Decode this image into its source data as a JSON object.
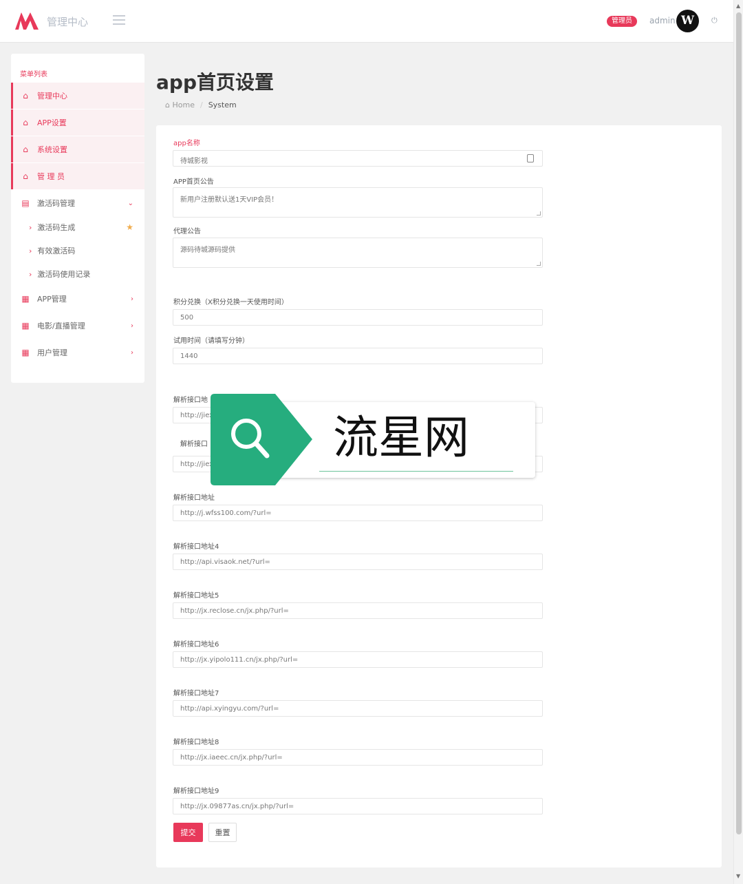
{
  "header": {
    "brand": "管理中心",
    "role_badge": "管理员",
    "username": "admin",
    "avatar_letter": "W"
  },
  "sidebar": {
    "title": "菜单列表",
    "items": [
      {
        "label": "管理中心"
      },
      {
        "label": "APP设置"
      },
      {
        "label": "系统设置"
      },
      {
        "label": "管 理 员"
      }
    ],
    "groups": [
      {
        "label": "激活码管理",
        "arrow": "⌄"
      },
      {
        "label": "APP管理",
        "arrow": "›"
      },
      {
        "label": "电影/直播管理",
        "arrow": "›"
      },
      {
        "label": "用户管理",
        "arrow": "›"
      }
    ],
    "subitems": [
      {
        "label": "激活码生成"
      },
      {
        "label": "有效激活码"
      },
      {
        "label": "激活码使用记录"
      }
    ]
  },
  "page": {
    "title": "app首页设置",
    "breadcrumb_home": "Home",
    "breadcrumb_current": "System"
  },
  "form": {
    "app_name_label": "app名称",
    "app_name_value": "待城影视",
    "notice_label": "APP首页公告",
    "notice_value": "新用户注册默认送1天VIP会员！",
    "agent_label": "代理公告",
    "agent_value": "源码待城源码提供",
    "points_label": "积分兑换（X积分兑换一天使用时间）",
    "points_value": "500",
    "trial_label": "试用时间（请填写分钟）",
    "trial_value": "1440",
    "api_fields": [
      {
        "label": "解析接口地",
        "value": "http://jiex"
      },
      {
        "label": "解析接口",
        "value": "http://jiex"
      },
      {
        "label": "解析接口地址",
        "value": "http://j.wfss100.com/?url="
      },
      {
        "label": "解析接口地址4",
        "value": "http://api.visaok.net/?url="
      },
      {
        "label": "解析接口地址5",
        "value": "http://jx.reclose.cn/jx.php/?url="
      },
      {
        "label": "解析接口地址6",
        "value": "http://jx.yipolo111.cn/jx.php/?url="
      },
      {
        "label": "解析接口地址7",
        "value": "http://api.xyingyu.com/?url="
      },
      {
        "label": "解析接口地址8",
        "value": "http://jx.iaeec.cn/jx.php/?url="
      },
      {
        "label": "解析接口地址9",
        "value": "http://jx.09877as.cn/jx.php/?url="
      }
    ],
    "submit_label": "提交",
    "reset_label": "重置"
  },
  "watermark": {
    "text": "流星网"
  },
  "colors": {
    "accent": "#e8395a",
    "watermark_green": "#26ad7e"
  }
}
